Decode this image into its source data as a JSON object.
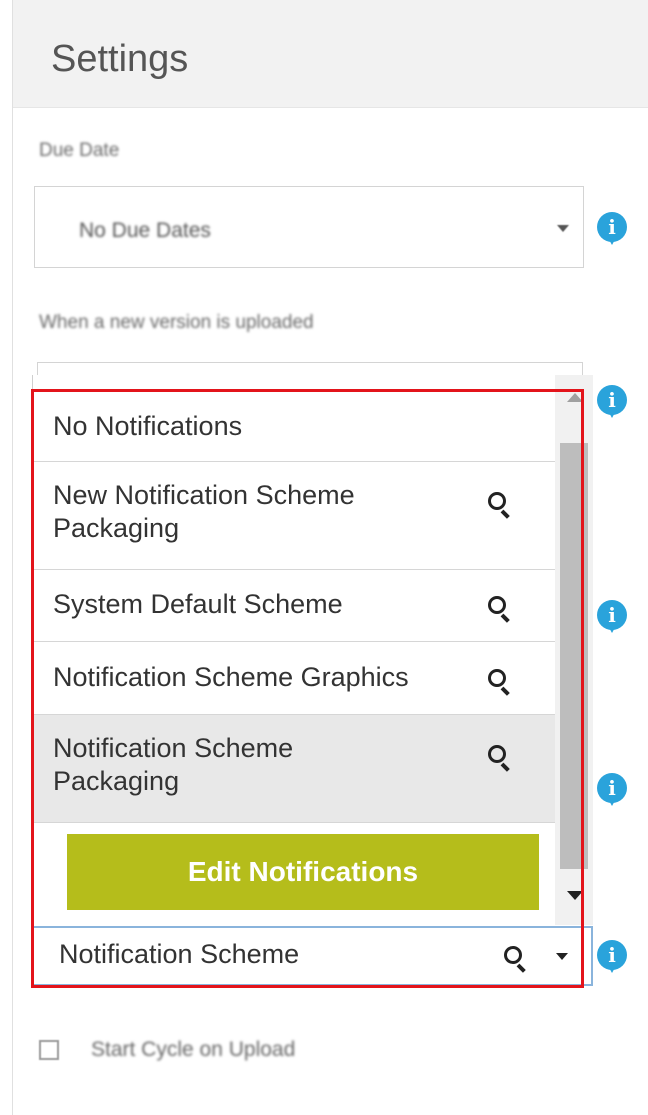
{
  "header": {
    "title": "Settings"
  },
  "due_date": {
    "label": "Due Date",
    "value": "No Due Dates"
  },
  "new_version": {
    "label": "When a new version is uploaded"
  },
  "notifications_dropdown": {
    "options": [
      {
        "label": "No Notifications",
        "has_search_icon": false
      },
      {
        "label_line1": "New Notification Scheme",
        "label_line2": "Packaging",
        "has_search_icon": true
      },
      {
        "label": "System Default Scheme",
        "has_search_icon": true
      },
      {
        "label": "Notification Scheme Graphics",
        "has_search_icon": true
      },
      {
        "label_line1": "Notification Scheme",
        "label_line2": "Packaging",
        "has_search_icon": true,
        "highlighted": true
      }
    ],
    "edit_button_label": "Edit Notifications",
    "selected_value": "Notification Scheme"
  },
  "start_cycle": {
    "label": "Start Cycle on Upload",
    "checked": false
  },
  "colors": {
    "info_icon": "#2aa3db",
    "edit_button": "#b5bd1b",
    "highlight_frame": "#e3141b",
    "header_bg": "#f2f2f2"
  },
  "icons": {
    "info": "info-icon",
    "search": "search-icon",
    "dropdown": "chevron-down-icon"
  }
}
